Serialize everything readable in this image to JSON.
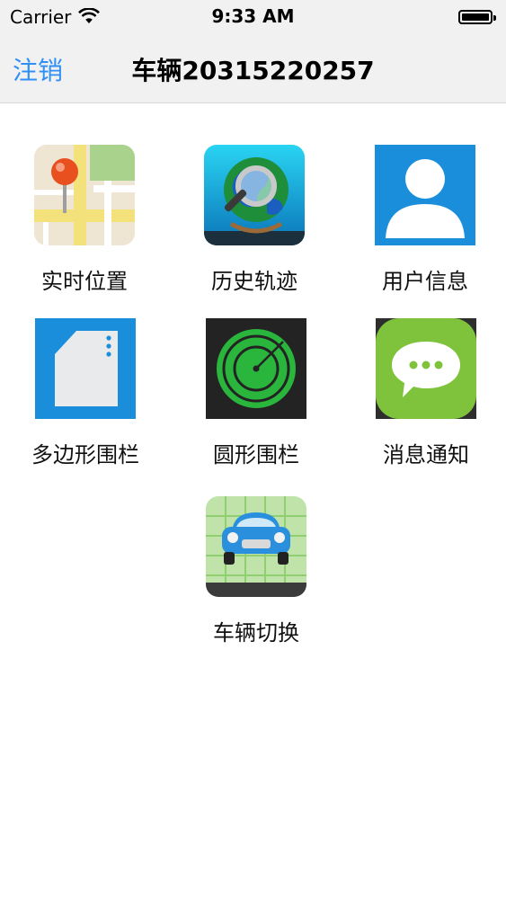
{
  "status_bar": {
    "carrier": "Carrier",
    "time": "9:33 AM"
  },
  "nav": {
    "back_label": "注销",
    "title": "车辆20315220257"
  },
  "colors": {
    "accent": "#2f8ff5",
    "nav_bg": "#f1f1f2"
  },
  "menu": {
    "items": [
      {
        "label": "实时位置",
        "icon": "map-pin-icon"
      },
      {
        "label": "历史轨迹",
        "icon": "globe-magnifier-icon"
      },
      {
        "label": "用户信息",
        "icon": "user-icon"
      },
      {
        "label": "多边形围栏",
        "icon": "polygon-document-icon"
      },
      {
        "label": "圆形围栏",
        "icon": "radar-icon"
      },
      {
        "label": "消息通知",
        "icon": "message-bubble-icon"
      },
      {
        "label": "车辆切换",
        "icon": "car-icon"
      }
    ]
  }
}
